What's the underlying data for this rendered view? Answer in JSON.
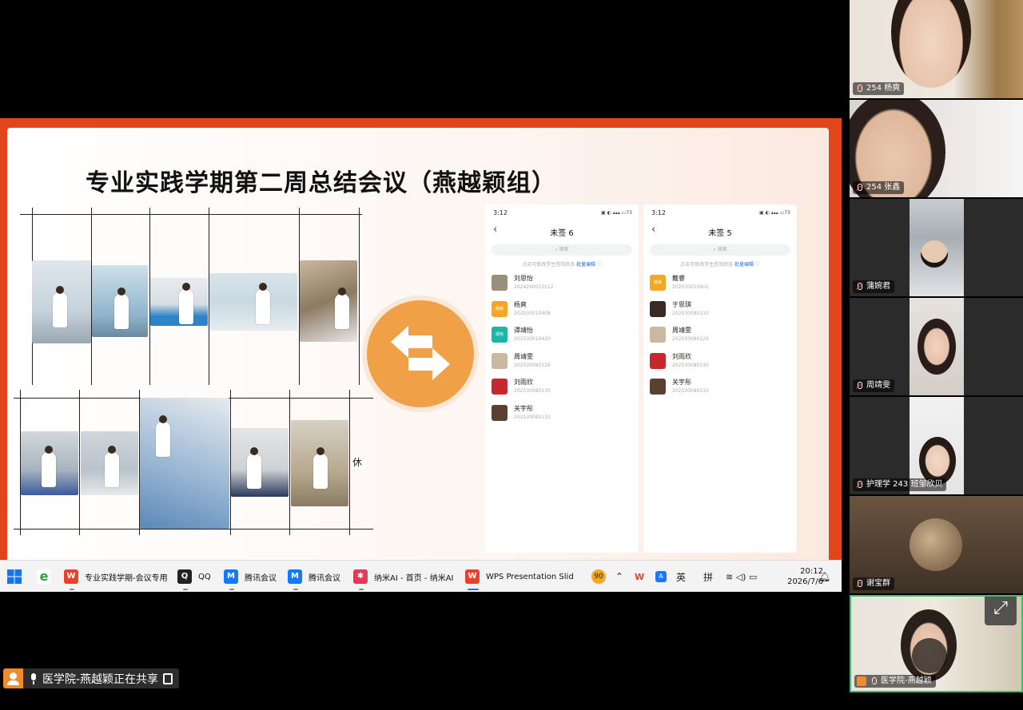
{
  "slide": {
    "title": "专业实践学期第二周总结会议（燕越颖组）",
    "rest_char": "休"
  },
  "phones": [
    {
      "time": "3:12",
      "battery": "73",
      "title": "未签 6",
      "search_placeholder": "搜索",
      "hint": "点击可修改学生签到状态",
      "hint_link": "批量编辑",
      "students": [
        {
          "name": "刘思怡",
          "id": "2024290010112",
          "avatar_text": "",
          "avatar_color": "#9a8f7a"
        },
        {
          "name": "杨爽",
          "id": "202530010408",
          "avatar_text": "杨爽",
          "avatar_color": "#f5a623"
        },
        {
          "name": "谭靖怡",
          "id": "202530010420",
          "avatar_text": "靖怡",
          "avatar_color": "#1bb7a6"
        },
        {
          "name": "周靖雯",
          "id": "202530080126",
          "avatar_text": "",
          "avatar_color": "#c9b9a0"
        },
        {
          "name": "刘雨欣",
          "id": "202530080130",
          "avatar_text": "",
          "avatar_color": "#c8282d"
        },
        {
          "name": "关宇彤",
          "id": "202530080132",
          "avatar_text": "",
          "avatar_color": "#5a4030"
        }
      ]
    },
    {
      "time": "3:12",
      "battery": "73",
      "title": "未签 5",
      "search_placeholder": "搜索",
      "hint": "点击可修改学生签到状态",
      "hint_link": "批量编辑",
      "students": [
        {
          "name": "戴睿",
          "id": "202530010401",
          "avatar_text": "戴睿",
          "avatar_color": "#f5a623"
        },
        {
          "name": "于思琪",
          "id": "202530080110",
          "avatar_text": "",
          "avatar_color": "#3a2a22"
        },
        {
          "name": "周靖雯",
          "id": "202530080126",
          "avatar_text": "",
          "avatar_color": "#c9b9a0"
        },
        {
          "name": "刘雨欣",
          "id": "202530080130",
          "avatar_text": "",
          "avatar_color": "#c8282d"
        },
        {
          "name": "关宇彤",
          "id": "202530080132",
          "avatar_text": "",
          "avatar_color": "#5a4030"
        }
      ]
    }
  ],
  "taskbar": {
    "items": [
      {
        "label": "专业实践学期-会议专用",
        "icon": "wps-icon",
        "icon_text": "W",
        "icon_color": "#e8412c"
      },
      {
        "label": "QQ",
        "icon": "qq-icon",
        "icon_text": "Q",
        "icon_color": "#222222"
      },
      {
        "label": "腾讯会议",
        "icon": "tencent-meeting-icon",
        "icon_text": "M",
        "icon_color": "#1677ff"
      },
      {
        "label": "腾讯会议",
        "icon": "tencent-meeting-icon",
        "icon_text": "M",
        "icon_color": "#1677ff"
      },
      {
        "label": "纳米AI - 首页 - 纳米AI",
        "icon": "nami-ai-icon",
        "icon_text": "✱",
        "icon_color": "#e23a5a"
      },
      {
        "label": "WPS Presentation Slid",
        "icon": "wps-presentation-icon",
        "icon_text": "W",
        "icon_color": "#e8412c"
      }
    ],
    "badge": "90",
    "ime_lang": "英",
    "ime_mode": "拼",
    "time": "20:12",
    "date": "2026/7/6"
  },
  "participants": [
    {
      "label": "254 杨爽"
    },
    {
      "label": "254 张鑫"
    },
    {
      "label": "蒲婉君"
    },
    {
      "label": "周靖雯"
    },
    {
      "label": "护理学 243 班邹欣贝"
    },
    {
      "label": "谢宝群"
    },
    {
      "label": "医学院-燕越颖"
    }
  ],
  "share_status": "医学院-燕越颖正在共享"
}
